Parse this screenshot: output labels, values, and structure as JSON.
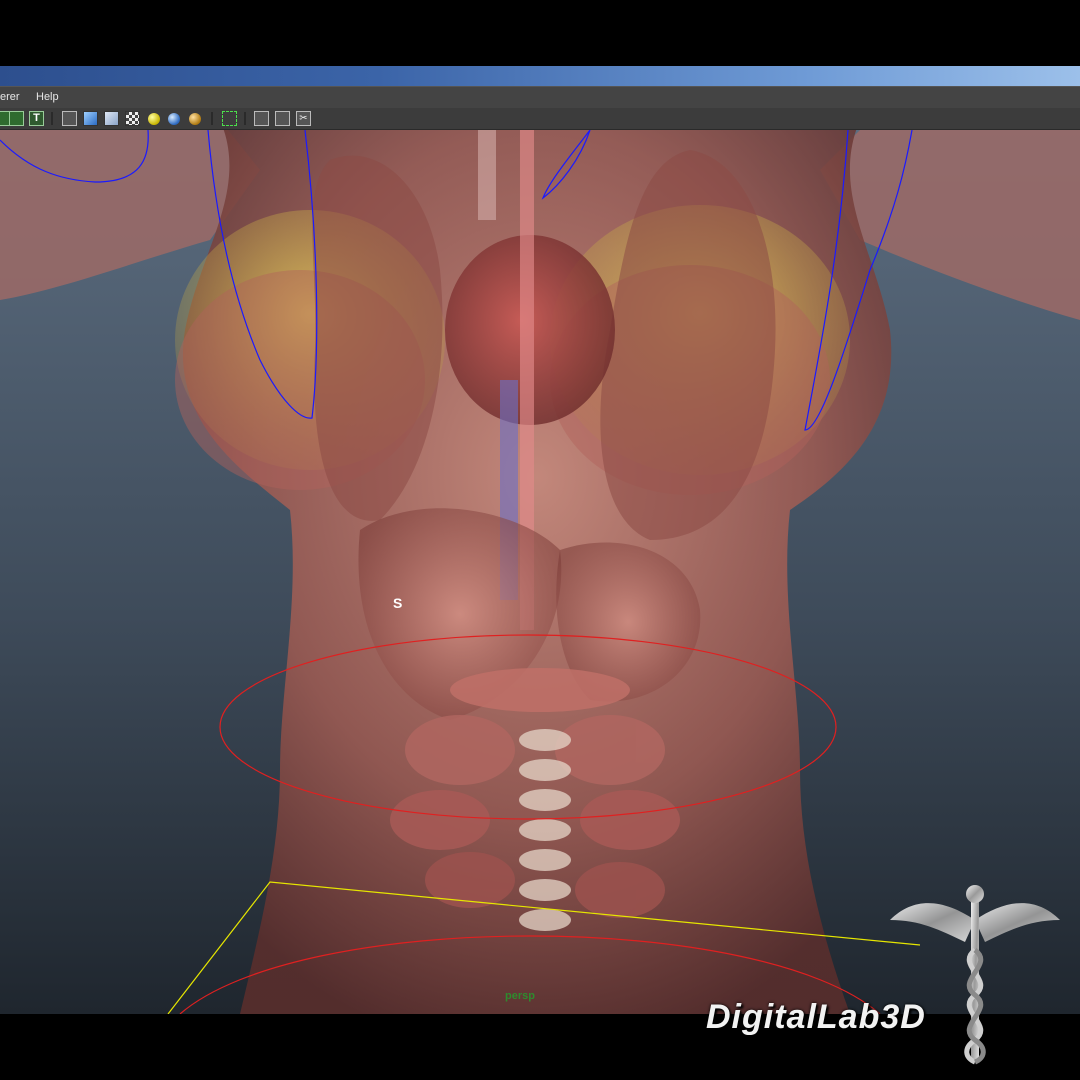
{
  "window": {
    "menu": [
      {
        "label": "erer"
      },
      {
        "label": "Help"
      }
    ]
  },
  "toolbar": {
    "icons": [
      "grid-icon",
      "texture-icon",
      "text-icon",
      "wireframe-cube-icon",
      "smooth-shade-cube-icon",
      "textured-cube-icon",
      "checker-icon",
      "light-yellow-icon",
      "light-blue-icon",
      "light-orange-icon",
      "select-highlight-icon",
      "isolate-cube-icon",
      "xray-icon",
      "scissors-icon"
    ]
  },
  "viewport": {
    "camera_label": "persp",
    "selected_object_label": "S"
  },
  "branding": {
    "text": "DigitalLab3D"
  },
  "colors": {
    "titlebar_start": "#2d4f8e",
    "titlebar_end": "#9cc0ea",
    "menu_bg": "#444444",
    "viewport_top": "#5c6d80",
    "viewport_bottom": "#1f262e",
    "curve_blue": "#1a1aff",
    "curve_red": "#e02020",
    "curve_yellow": "#e6e600"
  }
}
